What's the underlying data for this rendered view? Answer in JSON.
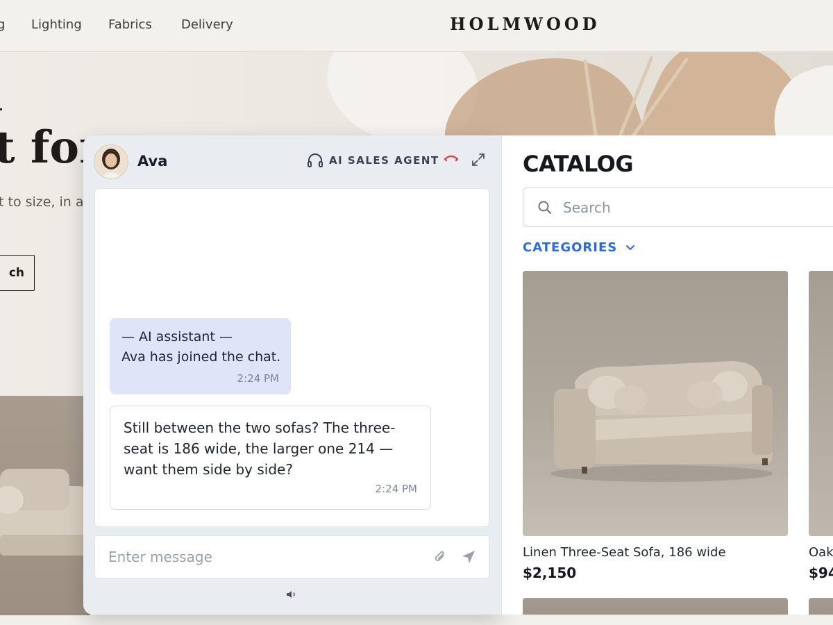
{
  "site": {
    "nav": [
      {
        "label": "g"
      },
      {
        "label": "Lighting"
      },
      {
        "label": "Fabrics"
      },
      {
        "label": "Delivery"
      }
    ],
    "brand": "HOLMWOOD",
    "hero": {
      "tick": ".",
      "heading": "t for",
      "subtitle": "t to size, in a",
      "button": "ch"
    }
  },
  "chat": {
    "agent_name": "Ava",
    "agent_role": "AI SALES AGENT",
    "icons": {
      "role": "headset-icon",
      "hangup": "hang-up-icon",
      "expand": "expand-icon",
      "attach": "paperclip-icon",
      "send": "send-icon",
      "volume": "speaker-icon"
    },
    "messages": [
      {
        "type": "system",
        "line1": "— AI assistant —",
        "line2": "Ava has joined the chat.",
        "time": "2:24 PM"
      },
      {
        "type": "agent",
        "text": "Still between the two sofas? The three-seat is 186 wide, the larger one 214 — want them side by side?",
        "time": "2:24 PM"
      }
    ],
    "composer_placeholder": "Enter message"
  },
  "catalog": {
    "title": "CATALOG",
    "search_placeholder": "Search",
    "categories_label": "CATEGORIES",
    "products": [
      {
        "name": "Linen Three-Seat Sofa, 186 wide",
        "price": "$2,150"
      },
      {
        "name": "Oak",
        "price": "$94"
      }
    ]
  },
  "colors": {
    "accent": "#2a6be3",
    "hangup": "#e0443c",
    "system_bubble": "#e0e4f8",
    "chat_panel_bg": "#e9edf2"
  }
}
